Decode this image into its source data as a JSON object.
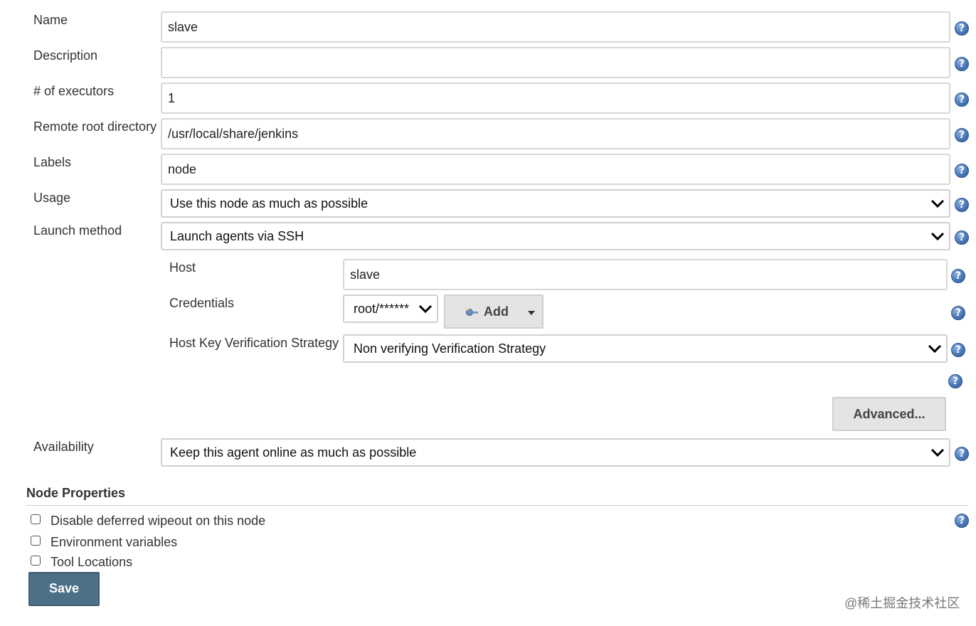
{
  "fields": {
    "name": {
      "label": "Name",
      "value": "slave"
    },
    "description": {
      "label": "Description",
      "value": ""
    },
    "executors": {
      "label": "# of executors",
      "value": "1"
    },
    "remote_root": {
      "label": "Remote root directory",
      "value": "/usr/local/share/jenkins"
    },
    "labels": {
      "label": "Labels",
      "value": "node"
    },
    "usage": {
      "label": "Usage",
      "value": "Use this node as much as possible"
    },
    "launch_method": {
      "label": "Launch method",
      "value": "Launch agents via SSH"
    },
    "availability": {
      "label": "Availability",
      "value": "Keep this agent online as much as possible"
    }
  },
  "ssh": {
    "host": {
      "label": "Host",
      "value": "slave"
    },
    "credentials": {
      "label": "Credentials",
      "value": "root/******",
      "add_label": "Add"
    },
    "host_key": {
      "label": "Host Key Verification Strategy",
      "value": "Non verifying Verification Strategy"
    },
    "advanced_label": "Advanced..."
  },
  "node_properties": {
    "title": "Node Properties",
    "items": [
      {
        "label": "Disable deferred wipeout on this node",
        "checked": false
      },
      {
        "label": "Environment variables",
        "checked": false
      },
      {
        "label": "Tool Locations",
        "checked": false
      }
    ]
  },
  "save_label": "Save",
  "watermark": "@稀土掘金技术社区",
  "icons": {
    "help": "help-icon",
    "chevron": "chevron-down-icon",
    "key": "key-icon",
    "caret": "caret-down-icon"
  },
  "colors": {
    "help_blue": "#4a79b8",
    "save_bg": "#4d6f88"
  }
}
